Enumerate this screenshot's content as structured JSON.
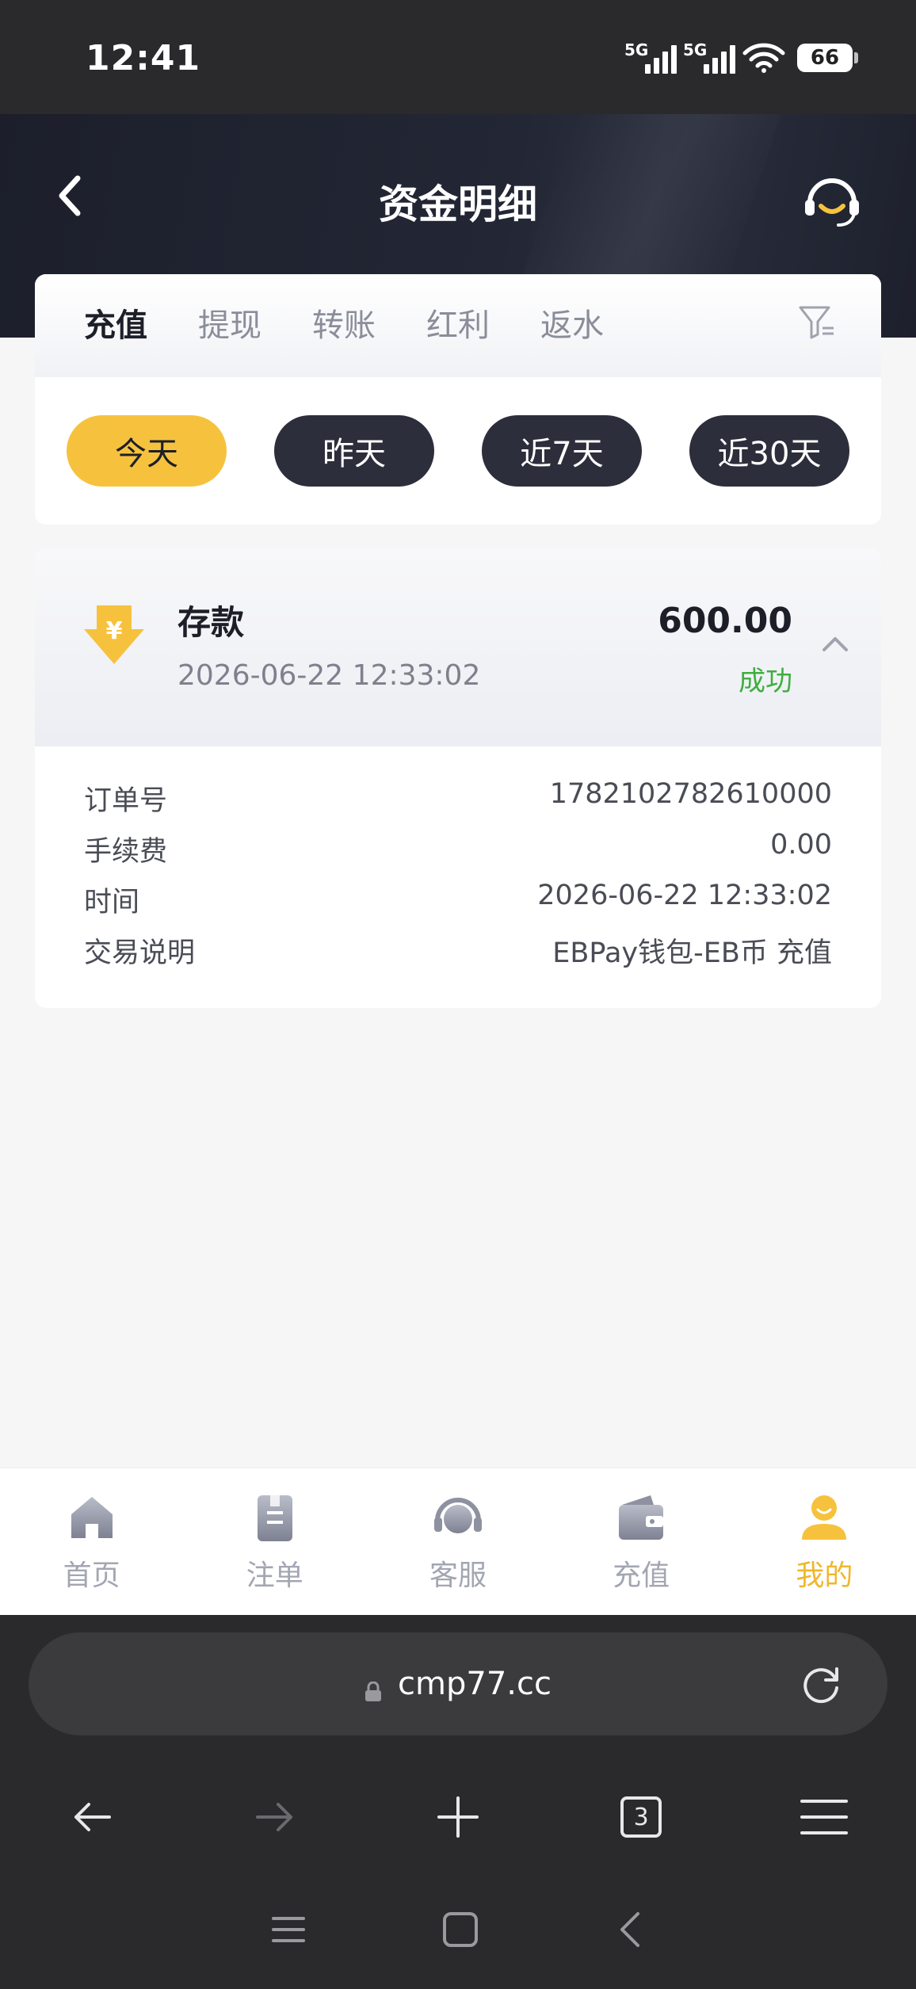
{
  "status_bar": {
    "time": "12:41",
    "network1": "5G",
    "network2": "5G",
    "battery": "66"
  },
  "header": {
    "title": "资金明细"
  },
  "tabs": [
    {
      "label": "充值",
      "active": true
    },
    {
      "label": "提现",
      "active": false
    },
    {
      "label": "转账",
      "active": false
    },
    {
      "label": "红利",
      "active": false
    },
    {
      "label": "返水",
      "active": false
    }
  ],
  "date_filters": [
    {
      "label": "今天",
      "active": true
    },
    {
      "label": "昨天",
      "active": false
    },
    {
      "label": "近7天",
      "active": false
    },
    {
      "label": "近30天",
      "active": false
    }
  ],
  "record": {
    "type": "存款",
    "datetime": "2026-06-22 12:33:02",
    "amount": "600.00",
    "status": "成功",
    "details": [
      {
        "label": "订单号",
        "value": "1782102782610000"
      },
      {
        "label": "手续费",
        "value": "0.00"
      },
      {
        "label": "时间",
        "value": "2026-06-22 12:33:02"
      },
      {
        "label": "交易说明",
        "value": "EBPay钱包-EB币 充值"
      }
    ]
  },
  "bottom_nav": [
    {
      "label": "首页",
      "icon": "home-icon",
      "active": false
    },
    {
      "label": "注单",
      "icon": "bets-icon",
      "active": false
    },
    {
      "label": "客服",
      "icon": "customer-service-icon",
      "active": false
    },
    {
      "label": "充值",
      "icon": "wallet-icon",
      "active": false
    },
    {
      "label": "我的",
      "icon": "profile-icon",
      "active": true
    }
  ],
  "browser": {
    "url": "cmp77.cc",
    "tab_count": "3"
  },
  "colors": {
    "accent": "#f6c23e",
    "success": "#3fae3f",
    "dark": "#2c2e3b"
  }
}
